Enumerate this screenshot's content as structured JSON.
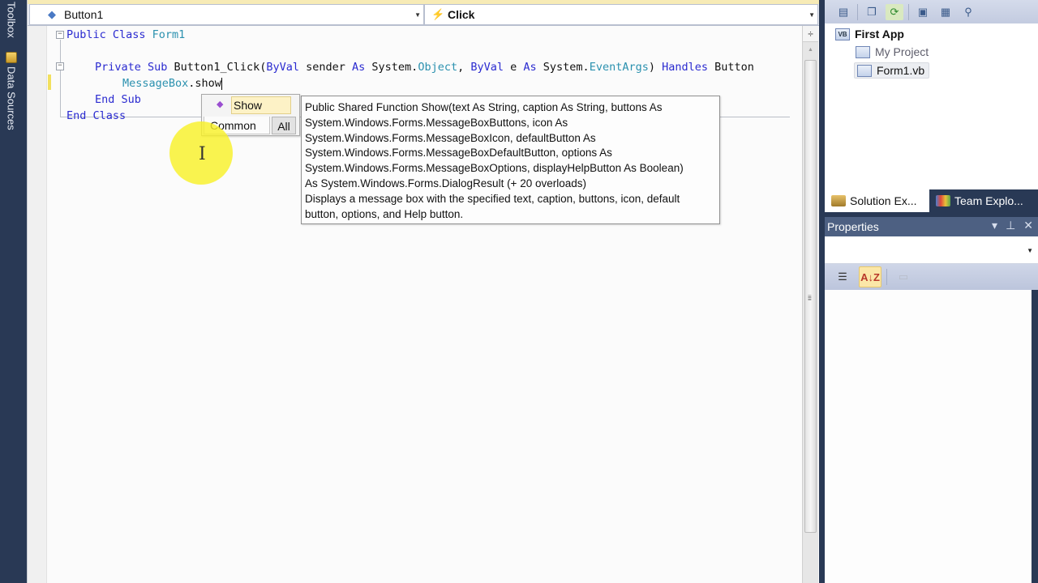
{
  "left_strip": {
    "tabs": [
      {
        "label": "Toolbox",
        "icon": "toolbox-icon"
      },
      {
        "label": "Data Sources",
        "icon": "data-sources-icon"
      }
    ]
  },
  "editor": {
    "nav": {
      "class_combo": {
        "value": "Button1",
        "icon": "control-icon"
      },
      "method_combo": {
        "value": "Click",
        "icon": "event-lightning-icon"
      }
    },
    "code_lines": {
      "l1": {
        "kw1": "Public Class ",
        "ty": "Form1"
      },
      "l2": {
        "kw_private": "Private Sub ",
        "name": "Button1_Click(",
        "kw_byval1": "ByVal",
        "sender": " sender ",
        "kw_as1": "As",
        "sys1": " System.",
        "ty_object": "Object",
        "comma": ", ",
        "kw_byval2": "ByVal",
        "e": " e ",
        "kw_as2": "As",
        "sys2": " System.",
        "ty_eventargs": "EventArgs",
        "close": ") ",
        "kw_handles": "Handles",
        "handles_target": " Button"
      },
      "l3": {
        "ty": "MessageBox",
        "rest": ".show"
      },
      "l4": {
        "kw": "End Sub"
      },
      "l5": {
        "kw": "End Class"
      }
    },
    "intellisense": {
      "selected_item": "Show",
      "item_icon": "method-icon",
      "tabs": {
        "common": "Common",
        "all": "All"
      },
      "active_tab": "Common"
    },
    "tooltip": {
      "lines": [
        "Public Shared Function Show(text As String, caption As String, buttons As",
        "System.Windows.Forms.MessageBoxButtons, icon As",
        "System.Windows.Forms.MessageBoxIcon, defaultButton As",
        "System.Windows.Forms.MessageBoxDefaultButton, options As",
        "System.Windows.Forms.MessageBoxOptions, displayHelpButton As Boolean)",
        "As System.Windows.Forms.DialogResult (+ 20 overloads)",
        "Displays a message box with the specified text, caption, buttons, icon, default",
        "button, options, and Help button."
      ]
    }
  },
  "solution_explorer": {
    "toolbar_icons": [
      "properties-icon",
      "show-all-files-icon",
      "refresh-icon",
      "view-code-icon",
      "view-designer-icon",
      "class-diagram-icon"
    ],
    "tree": {
      "root": "First App",
      "items": [
        "My Project",
        "Form1.vb"
      ],
      "selected": "Form1.vb"
    },
    "tabs": [
      {
        "label": "Solution Ex...",
        "active": true
      },
      {
        "label": "Team Explo...",
        "active": false
      }
    ]
  },
  "properties": {
    "title": "Properties",
    "controls": {
      "dropdown": "▾",
      "pin": "⊥",
      "close": "✕"
    },
    "object_combo_value": "",
    "toolbar": {
      "categorized": "categorized-icon",
      "alphabetical": "A↓Z",
      "property_pages": "property-pages-icon"
    }
  }
}
